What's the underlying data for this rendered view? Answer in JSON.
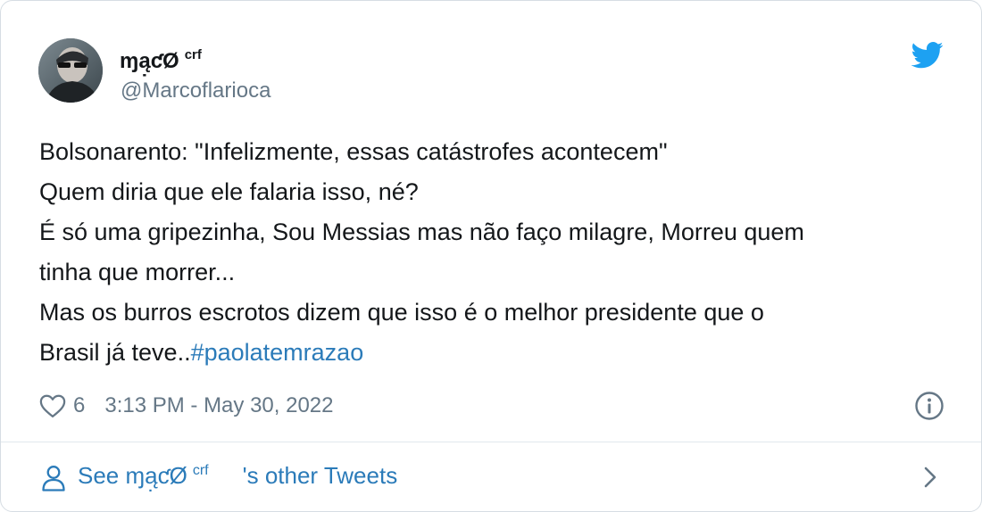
{
  "tweet": {
    "display_name": "ɱą̣ƈØ",
    "display_name_sup": "crf",
    "handle": "@Marcoflarioca",
    "text_lines": [
      "Bolsonarento: \"Infelizmente, essas catástrofes acontecem\"",
      "Quem diria que ele falaria isso, né?",
      "É só uma gripezinha, Sou Messias mas não faço milagre, Morreu quem",
      "tinha que morrer...",
      "Mas os burros escrotos dizem que isso é o melhor presidente que o",
      "Brasil já teve.."
    ],
    "hashtag": "#paolatemrazao",
    "likes": "6",
    "timestamp": "3:13 PM - May 30, 2022"
  },
  "footer": {
    "see_prefix": "See",
    "name": "ɱą̣ƈØ",
    "name_sup": "crf",
    "suffix": "'s other Tweets"
  },
  "icons": {
    "brand": "twitter-bird-icon",
    "like": "heart-icon",
    "info": "info-icon",
    "profile": "person-icon",
    "next": "chevron-right-icon"
  },
  "colors": {
    "twitter_blue": "#1da1f2",
    "link_blue": "#2b7bb9",
    "text": "#14171a",
    "muted": "#657786",
    "border": "#d6dde3"
  }
}
